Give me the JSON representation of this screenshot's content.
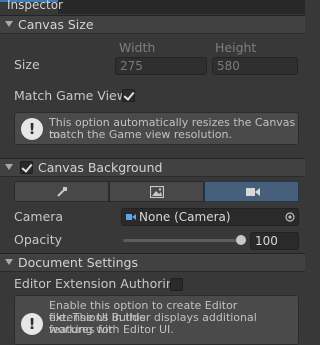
{
  "window": {
    "tab_title": "Inspector"
  },
  "canvas_size": {
    "section_title": "Canvas Size",
    "width_header": "Width",
    "height_header": "Height",
    "size_label": "Size",
    "width_value": "275",
    "height_value": "580",
    "match_game_view_label": "Match Game View",
    "match_game_view_checked": true,
    "help_text_line1": "This option automatically resizes the Canvas to",
    "help_text_line2": "match the Game view resolution."
  },
  "canvas_background": {
    "section_title": "Canvas Background",
    "enabled": true,
    "modes": [
      {
        "name": "color",
        "icon": "eyedropper-icon",
        "active": false
      },
      {
        "name": "image",
        "icon": "image-icon",
        "active": false
      },
      {
        "name": "camera",
        "icon": "camera-icon",
        "active": true
      }
    ],
    "camera_label": "Camera",
    "camera_value": "None (Camera)",
    "opacity_label": "Opacity",
    "opacity_value": "100",
    "opacity_fraction": 1.0
  },
  "document_settings": {
    "section_title": "Document Settings",
    "editor_extension_label": "Editor Extension Authoring",
    "editor_extension_checked": false,
    "help_text_line1": "Enable this option to create Editor extensions in this",
    "help_text_line2": "file. The UI Builder displays additional features for",
    "help_text_line3": "working with Editor UI."
  }
}
